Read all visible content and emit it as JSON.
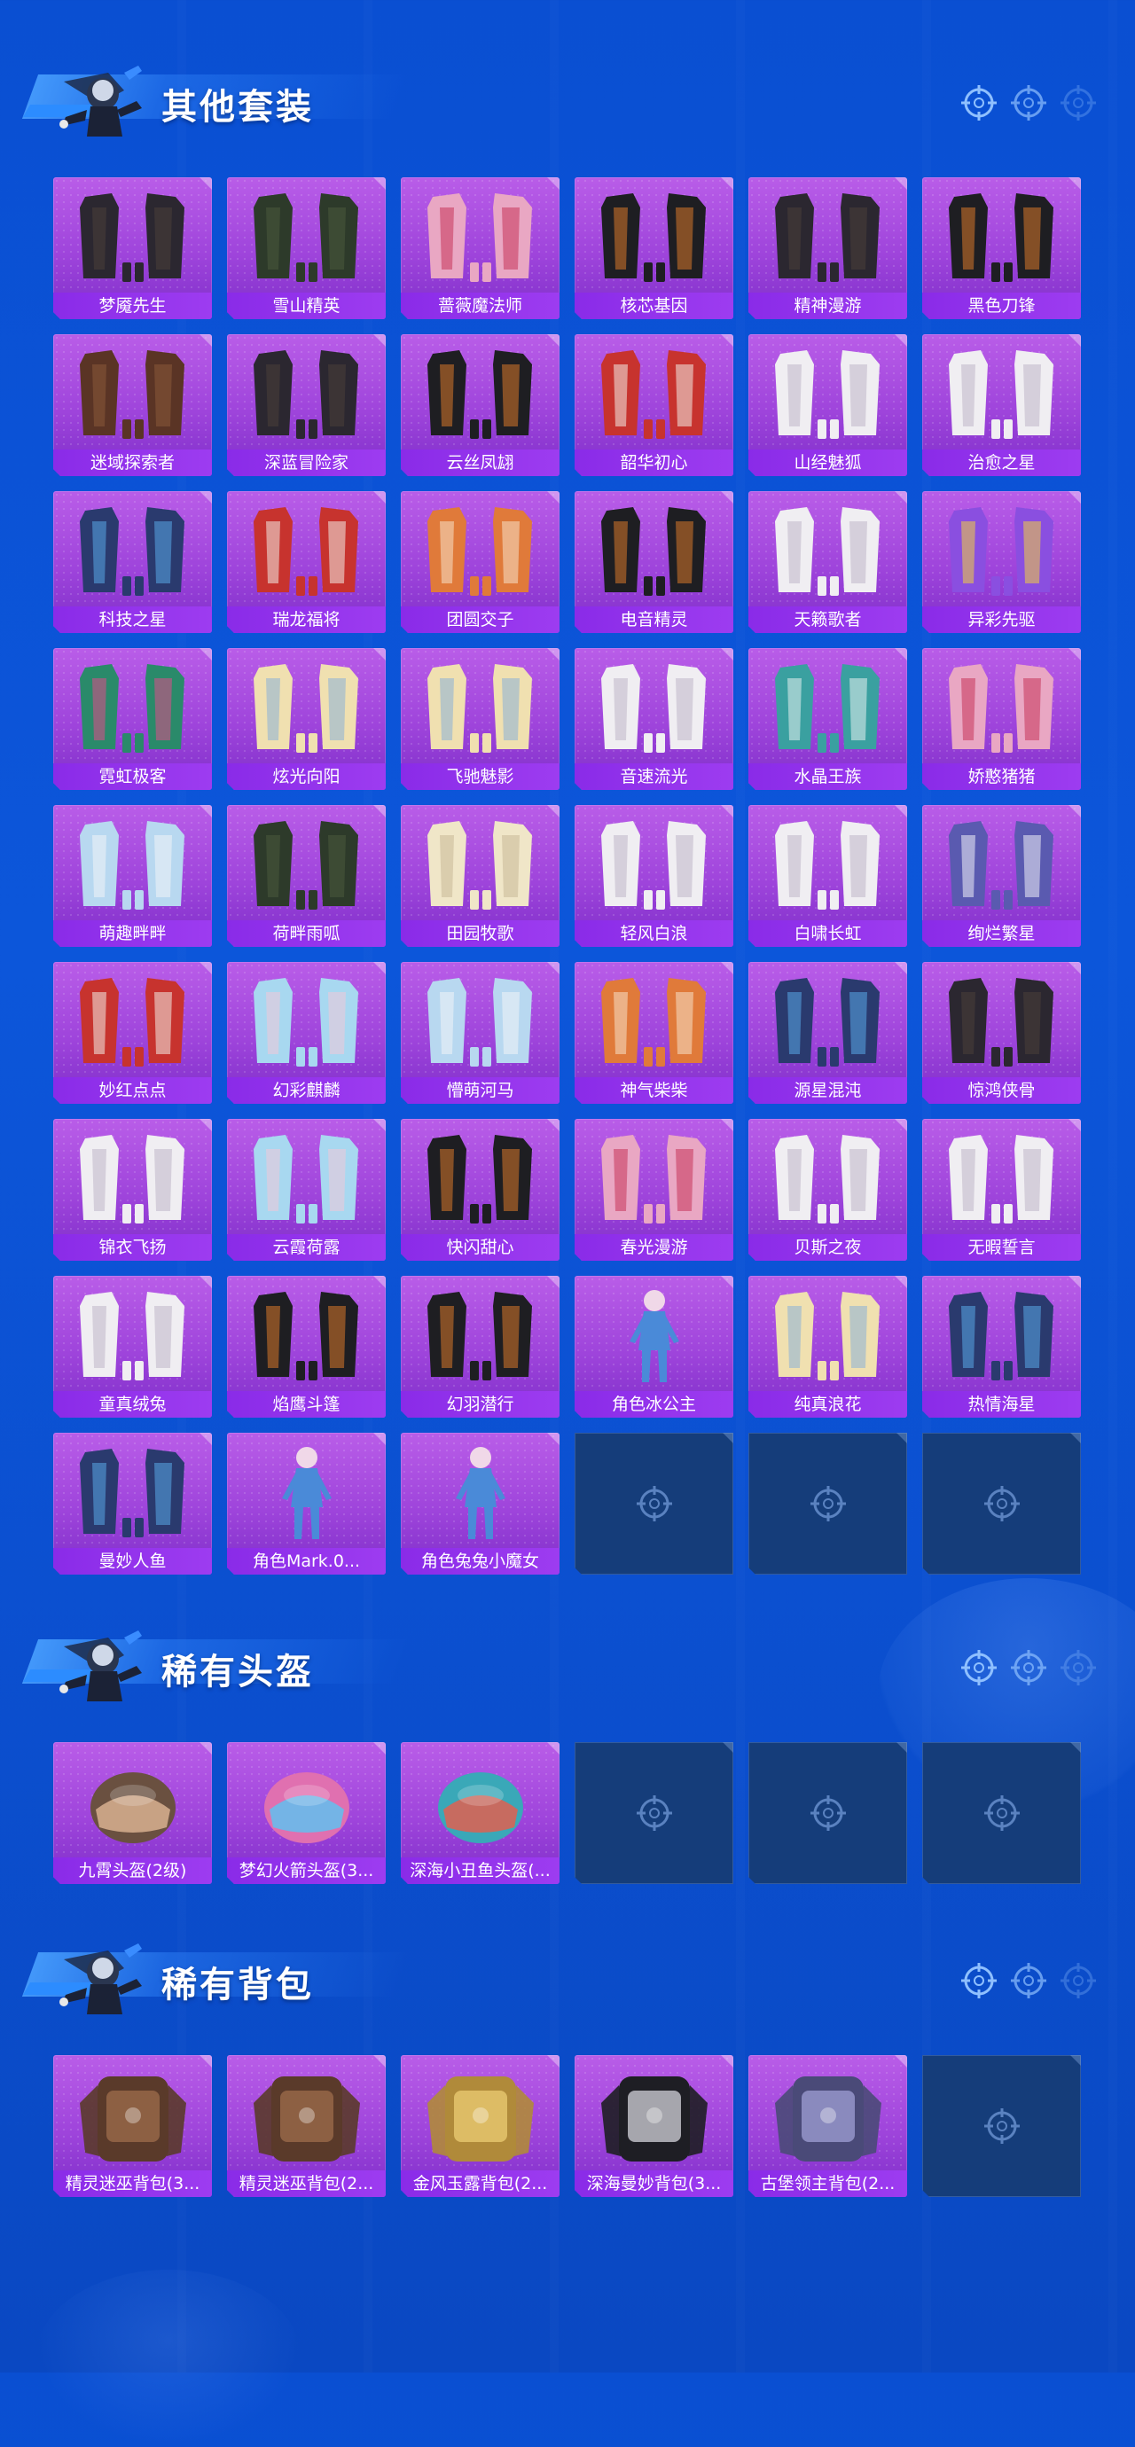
{
  "colors": {
    "background": "#0b52d6",
    "card": "#a64ae0",
    "label_bar": "#922fe9",
    "empty_slot": "#153d7a"
  },
  "sections": [
    {
      "title": "其他套装",
      "items": [
        {
          "label": "梦魇先生",
          "icon": "outfit-dark-coat"
        },
        {
          "label": "雪山精英",
          "icon": "outfit-green-coat"
        },
        {
          "label": "蔷薇魔法师",
          "icon": "outfit-pink-dress"
        },
        {
          "label": "核芯基因",
          "icon": "outfit-black-orange"
        },
        {
          "label": "精神漫游",
          "icon": "outfit-dark-armor"
        },
        {
          "label": "黑色刀锋",
          "icon": "outfit-black-coat"
        },
        {
          "label": "迷域探索者",
          "icon": "outfit-brown-coat"
        },
        {
          "label": "深蓝冒险家",
          "icon": "outfit-dark-coat"
        },
        {
          "label": "云丝凤翃",
          "icon": "outfit-black-robe"
        },
        {
          "label": "韶华初心",
          "icon": "outfit-red-set"
        },
        {
          "label": "山经魅狐",
          "icon": "outfit-white-robe"
        },
        {
          "label": "治愈之星",
          "icon": "outfit-white-set"
        },
        {
          "label": "科技之星",
          "icon": "outfit-blue-tech"
        },
        {
          "label": "瑞龙福将",
          "icon": "outfit-red-armor"
        },
        {
          "label": "团圆交子",
          "icon": "outfit-orange-set"
        },
        {
          "label": "电音精灵",
          "icon": "outfit-black-jacket"
        },
        {
          "label": "天籁歌者",
          "icon": "outfit-white-set"
        },
        {
          "label": "异彩先驱",
          "icon": "outfit-colorful"
        },
        {
          "label": "霓虹极客",
          "icon": "outfit-neon"
        },
        {
          "label": "炫光向阳",
          "icon": "outfit-yellow-white"
        },
        {
          "label": "飞驰魅影",
          "icon": "outfit-yellow-white"
        },
        {
          "label": "音速流光",
          "icon": "outfit-white-blue"
        },
        {
          "label": "水晶王族",
          "icon": "outfit-teal-set"
        },
        {
          "label": "娇憨猪猪",
          "icon": "outfit-pink-set"
        },
        {
          "label": "萌趣畔畔",
          "icon": "outfit-light-blue"
        },
        {
          "label": "荷畔雨呱",
          "icon": "outfit-green-frog"
        },
        {
          "label": "田园牧歌",
          "icon": "outfit-cream-set"
        },
        {
          "label": "轻风白浪",
          "icon": "outfit-white-blue"
        },
        {
          "label": "白啸长虹",
          "icon": "outfit-white-black"
        },
        {
          "label": "绚烂繁星",
          "icon": "outfit-starry"
        },
        {
          "label": "妙红点点",
          "icon": "outfit-red-dress"
        },
        {
          "label": "幻彩麒麟",
          "icon": "outfit-pastel"
        },
        {
          "label": "懵萌河马",
          "icon": "outfit-light-blue"
        },
        {
          "label": "神气柴柴",
          "icon": "outfit-orange-white"
        },
        {
          "label": "源星混沌",
          "icon": "outfit-blue-suit"
        },
        {
          "label": "惊鸿侠骨",
          "icon": "outfit-dark-red-robe"
        },
        {
          "label": "锦衣飞扬",
          "icon": "outfit-white-robe"
        },
        {
          "label": "云霞荷露",
          "icon": "outfit-pastel-dress"
        },
        {
          "label": "快闪甜心",
          "icon": "outfit-black-pink"
        },
        {
          "label": "春光漫游",
          "icon": "outfit-pink-jacket"
        },
        {
          "label": "贝斯之夜",
          "icon": "outfit-white-red"
        },
        {
          "label": "无暇誓言",
          "icon": "outfit-white-dress"
        },
        {
          "label": "童真绒兔",
          "icon": "outfit-white-bunny"
        },
        {
          "label": "焰鹰斗篷",
          "icon": "outfit-black-red-cloak"
        },
        {
          "label": "幻羽潜行",
          "icon": "outfit-black-green"
        },
        {
          "label": "角色冰公主",
          "icon": "character-ice-princess"
        },
        {
          "label": "纯真浪花",
          "icon": "outfit-yellow-teal"
        },
        {
          "label": "热情海星",
          "icon": "outfit-blue-pink"
        },
        {
          "label": "曼妙人鱼",
          "icon": "outfit-blue-mermaid"
        },
        {
          "label": "角色Mark.0...",
          "icon": "character-mark"
        },
        {
          "label": "角色兔兔小魔女",
          "icon": "character-bunny-witch"
        }
      ],
      "empty_slots": 3
    },
    {
      "title": "稀有头盔",
      "items": [
        {
          "label": "九霄头盔(2级)",
          "icon": "helmet-brown"
        },
        {
          "label": "梦幻火箭头盔(3...",
          "icon": "helmet-pink-rocket"
        },
        {
          "label": "深海小丑鱼头盔(...",
          "icon": "helmet-teal-fish"
        }
      ],
      "empty_slots": 3
    },
    {
      "title": "稀有背包",
      "items": [
        {
          "label": "精灵迷巫背包(3...",
          "icon": "backpack-brown"
        },
        {
          "label": "精灵迷巫背包(2...",
          "icon": "backpack-brown"
        },
        {
          "label": "金风玉露背包(2...",
          "icon": "backpack-gold"
        },
        {
          "label": "深海曼妙背包(3...",
          "icon": "backpack-diving"
        },
        {
          "label": "古堡领主背包(2...",
          "icon": "backpack-purple-shield"
        }
      ],
      "empty_slots": 1
    }
  ]
}
